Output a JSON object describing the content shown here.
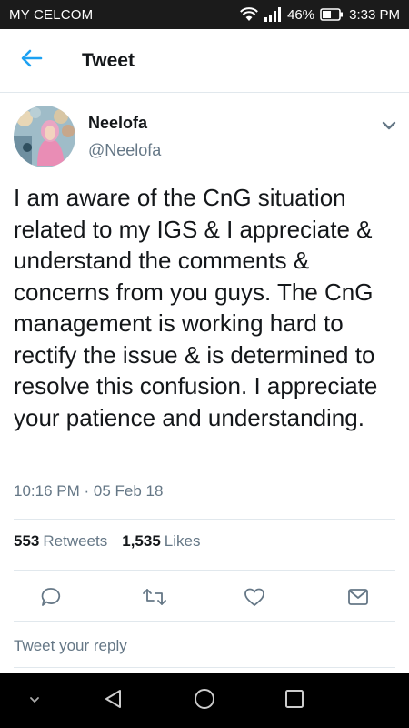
{
  "status_bar": {
    "carrier": "MY CELCOM",
    "battery": "46%",
    "time": "3:33 PM"
  },
  "header": {
    "title": "Tweet",
    "back_icon": "arrow-left-icon"
  },
  "tweet": {
    "display_name": "Neelofa",
    "handle": "@Neelofa",
    "text": "I am aware of the CnG situation related to my IGS & I appreciate & understand the comments & concerns from you guys. The CnG management is working hard to rectify the issue & is determined to resolve this confusion. I appreciate your patience and understanding.",
    "timestamp": "10:16 PM · 05 Feb 18"
  },
  "stats": {
    "retweets_count": "553",
    "retweets_label": "Retweets",
    "likes_count": "1,535",
    "likes_label": "Likes"
  },
  "actions": {
    "icons": [
      "reply-icon",
      "retweet-icon",
      "like-icon",
      "message-icon"
    ]
  },
  "reply": {
    "placeholder": "Tweet your reply"
  },
  "colors": {
    "accent": "#1da1f2",
    "text_primary": "#14171a",
    "text_secondary": "#657786",
    "divider": "#e1e8ed",
    "status_bar": "#1b1b1b",
    "nav_bar": "#000000"
  }
}
